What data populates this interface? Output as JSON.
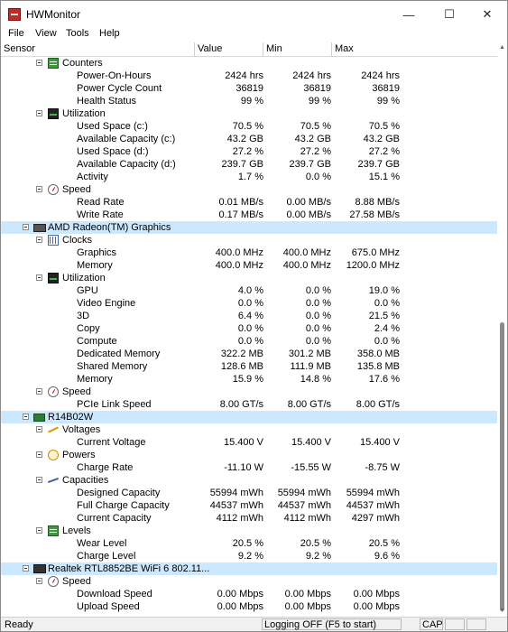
{
  "window": {
    "title": "HWMonitor"
  },
  "menu": [
    "File",
    "View",
    "Tools",
    "Help"
  ],
  "columns": [
    "Sensor",
    "Value",
    "Min",
    "Max"
  ],
  "rows": [
    {
      "label": "Counters",
      "level": 2,
      "icon": "counters",
      "expander": true,
      "v": [
        "",
        "",
        ""
      ]
    },
    {
      "label": "Power-On-Hours",
      "level": 3,
      "v": [
        "2424 hrs",
        "2424 hrs",
        "2424 hrs"
      ]
    },
    {
      "label": "Power Cycle Count",
      "level": 3,
      "v": [
        "36819",
        "36819",
        "36819"
      ]
    },
    {
      "label": "Health Status",
      "level": 3,
      "v": [
        "99 %",
        "99 %",
        "99 %"
      ]
    },
    {
      "label": "Utilization",
      "level": 2,
      "icon": "util",
      "expander": true,
      "v": [
        "",
        "",
        ""
      ]
    },
    {
      "label": "Used Space (c:)",
      "level": 3,
      "v": [
        "70.5 %",
        "70.5 %",
        "70.5 %"
      ]
    },
    {
      "label": "Available Capacity (c:)",
      "level": 3,
      "v": [
        "43.2 GB",
        "43.2 GB",
        "43.2 GB"
      ]
    },
    {
      "label": "Used Space (d:)",
      "level": 3,
      "v": [
        "27.2 %",
        "27.2 %",
        "27.2 %"
      ]
    },
    {
      "label": "Available Capacity (d:)",
      "level": 3,
      "v": [
        "239.7 GB",
        "239.7 GB",
        "239.7 GB"
      ]
    },
    {
      "label": "Activity",
      "level": 3,
      "v": [
        "1.7 %",
        "0.0 %",
        "15.1 %"
      ]
    },
    {
      "label": "Speed",
      "level": 2,
      "icon": "speed",
      "expander": true,
      "v": [
        "",
        "",
        ""
      ]
    },
    {
      "label": "Read Rate",
      "level": 3,
      "v": [
        "0.01 MB/s",
        "0.00 MB/s",
        "8.88 MB/s"
      ]
    },
    {
      "label": "Write Rate",
      "level": 3,
      "v": [
        "0.17 MB/s",
        "0.00 MB/s",
        "27.58 MB/s"
      ]
    },
    {
      "label": "AMD Radeon(TM) Graphics",
      "level": 1,
      "icon": "gpu",
      "expander": true,
      "selected": true,
      "v": [
        "",
        "",
        ""
      ]
    },
    {
      "label": "Clocks",
      "level": 2,
      "icon": "clock",
      "expander": true,
      "v": [
        "",
        "",
        ""
      ]
    },
    {
      "label": "Graphics",
      "level": 3,
      "v": [
        "400.0 MHz",
        "400.0 MHz",
        "675.0 MHz"
      ]
    },
    {
      "label": "Memory",
      "level": 3,
      "v": [
        "400.0 MHz",
        "400.0 MHz",
        "1200.0 MHz"
      ]
    },
    {
      "label": "Utilization",
      "level": 2,
      "icon": "util",
      "expander": true,
      "v": [
        "",
        "",
        ""
      ]
    },
    {
      "label": "GPU",
      "level": 3,
      "v": [
        "4.0 %",
        "0.0 %",
        "19.0 %"
      ]
    },
    {
      "label": "Video Engine",
      "level": 3,
      "v": [
        "0.0 %",
        "0.0 %",
        "0.0 %"
      ]
    },
    {
      "label": "3D",
      "level": 3,
      "v": [
        "6.4 %",
        "0.0 %",
        "21.5 %"
      ]
    },
    {
      "label": "Copy",
      "level": 3,
      "v": [
        "0.0 %",
        "0.0 %",
        "2.4 %"
      ]
    },
    {
      "label": "Compute",
      "level": 3,
      "v": [
        "0.0 %",
        "0.0 %",
        "0.0 %"
      ]
    },
    {
      "label": "Dedicated Memory",
      "level": 3,
      "v": [
        "322.2 MB",
        "301.2 MB",
        "358.0 MB"
      ]
    },
    {
      "label": "Shared Memory",
      "level": 3,
      "v": [
        "128.6 MB",
        "111.9 MB",
        "135.8 MB"
      ]
    },
    {
      "label": "Memory",
      "level": 3,
      "v": [
        "15.9 %",
        "14.8 %",
        "17.6 %"
      ]
    },
    {
      "label": "Speed",
      "level": 2,
      "icon": "speed",
      "expander": true,
      "v": [
        "",
        "",
        ""
      ]
    },
    {
      "label": "PCIe Link Speed",
      "level": 3,
      "v": [
        "8.00 GT/s",
        "8.00 GT/s",
        "8.00 GT/s"
      ]
    },
    {
      "label": "R14B02W",
      "level": 1,
      "icon": "batt",
      "expander": true,
      "selected": true,
      "v": [
        "",
        "",
        ""
      ]
    },
    {
      "label": "Voltages",
      "level": 2,
      "icon": "volt",
      "expander": true,
      "v": [
        "",
        "",
        ""
      ]
    },
    {
      "label": "Current Voltage",
      "level": 3,
      "v": [
        "15.400 V",
        "15.400 V",
        "15.400 V"
      ]
    },
    {
      "label": "Powers",
      "level": 2,
      "icon": "power",
      "expander": true,
      "v": [
        "",
        "",
        ""
      ]
    },
    {
      "label": "Charge Rate",
      "level": 3,
      "v": [
        "-11.10 W",
        "-15.55 W",
        "-8.75 W"
      ]
    },
    {
      "label": "Capacities",
      "level": 2,
      "icon": "cap",
      "expander": true,
      "v": [
        "",
        "",
        ""
      ]
    },
    {
      "label": "Designed Capacity",
      "level": 3,
      "v": [
        "55994 mWh",
        "55994 mWh",
        "55994 mWh"
      ]
    },
    {
      "label": "Full Charge Capacity",
      "level": 3,
      "v": [
        "44537 mWh",
        "44537 mWh",
        "44537 mWh"
      ]
    },
    {
      "label": "Current Capacity",
      "level": 3,
      "v": [
        "4112 mWh",
        "4112 mWh",
        "4297 mWh"
      ]
    },
    {
      "label": "Levels",
      "level": 2,
      "icon": "counters",
      "expander": true,
      "v": [
        "",
        "",
        ""
      ]
    },
    {
      "label": "Wear Level",
      "level": 3,
      "v": [
        "20.5 %",
        "20.5 %",
        "20.5 %"
      ]
    },
    {
      "label": "Charge Level",
      "level": 3,
      "v": [
        "9.2 %",
        "9.2 %",
        "9.6 %"
      ]
    },
    {
      "label": "Realtek RTL8852BE WiFi 6 802.11...",
      "level": 1,
      "icon": "wifi",
      "expander": true,
      "selected": true,
      "v": [
        "",
        "",
        ""
      ]
    },
    {
      "label": "Speed",
      "level": 2,
      "icon": "speed",
      "expander": true,
      "v": [
        "",
        "",
        ""
      ]
    },
    {
      "label": "Download Speed",
      "level": 3,
      "v": [
        "0.00 Mbps",
        "0.00 Mbps",
        "0.00 Mbps"
      ]
    },
    {
      "label": "Upload Speed",
      "level": 3,
      "v": [
        "0.00 Mbps",
        "0.00 Mbps",
        "0.00 Mbps"
      ]
    }
  ],
  "status": {
    "left": "Ready",
    "logging": "Logging OFF (F5 to start)",
    "caps": "CAP"
  }
}
